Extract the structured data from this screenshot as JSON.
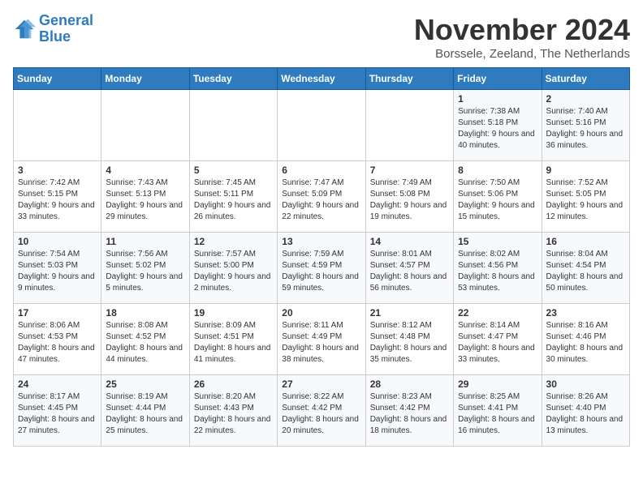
{
  "header": {
    "logo_line1": "General",
    "logo_line2": "Blue",
    "month": "November 2024",
    "location": "Borssele, Zeeland, The Netherlands"
  },
  "weekdays": [
    "Sunday",
    "Monday",
    "Tuesday",
    "Wednesday",
    "Thursday",
    "Friday",
    "Saturday"
  ],
  "weeks": [
    [
      {
        "day": "",
        "info": ""
      },
      {
        "day": "",
        "info": ""
      },
      {
        "day": "",
        "info": ""
      },
      {
        "day": "",
        "info": ""
      },
      {
        "day": "",
        "info": ""
      },
      {
        "day": "1",
        "info": "Sunrise: 7:38 AM\nSunset: 5:18 PM\nDaylight: 9 hours and 40 minutes."
      },
      {
        "day": "2",
        "info": "Sunrise: 7:40 AM\nSunset: 5:16 PM\nDaylight: 9 hours and 36 minutes."
      }
    ],
    [
      {
        "day": "3",
        "info": "Sunrise: 7:42 AM\nSunset: 5:15 PM\nDaylight: 9 hours and 33 minutes."
      },
      {
        "day": "4",
        "info": "Sunrise: 7:43 AM\nSunset: 5:13 PM\nDaylight: 9 hours and 29 minutes."
      },
      {
        "day": "5",
        "info": "Sunrise: 7:45 AM\nSunset: 5:11 PM\nDaylight: 9 hours and 26 minutes."
      },
      {
        "day": "6",
        "info": "Sunrise: 7:47 AM\nSunset: 5:09 PM\nDaylight: 9 hours and 22 minutes."
      },
      {
        "day": "7",
        "info": "Sunrise: 7:49 AM\nSunset: 5:08 PM\nDaylight: 9 hours and 19 minutes."
      },
      {
        "day": "8",
        "info": "Sunrise: 7:50 AM\nSunset: 5:06 PM\nDaylight: 9 hours and 15 minutes."
      },
      {
        "day": "9",
        "info": "Sunrise: 7:52 AM\nSunset: 5:05 PM\nDaylight: 9 hours and 12 minutes."
      }
    ],
    [
      {
        "day": "10",
        "info": "Sunrise: 7:54 AM\nSunset: 5:03 PM\nDaylight: 9 hours and 9 minutes."
      },
      {
        "day": "11",
        "info": "Sunrise: 7:56 AM\nSunset: 5:02 PM\nDaylight: 9 hours and 5 minutes."
      },
      {
        "day": "12",
        "info": "Sunrise: 7:57 AM\nSunset: 5:00 PM\nDaylight: 9 hours and 2 minutes."
      },
      {
        "day": "13",
        "info": "Sunrise: 7:59 AM\nSunset: 4:59 PM\nDaylight: 8 hours and 59 minutes."
      },
      {
        "day": "14",
        "info": "Sunrise: 8:01 AM\nSunset: 4:57 PM\nDaylight: 8 hours and 56 minutes."
      },
      {
        "day": "15",
        "info": "Sunrise: 8:02 AM\nSunset: 4:56 PM\nDaylight: 8 hours and 53 minutes."
      },
      {
        "day": "16",
        "info": "Sunrise: 8:04 AM\nSunset: 4:54 PM\nDaylight: 8 hours and 50 minutes."
      }
    ],
    [
      {
        "day": "17",
        "info": "Sunrise: 8:06 AM\nSunset: 4:53 PM\nDaylight: 8 hours and 47 minutes."
      },
      {
        "day": "18",
        "info": "Sunrise: 8:08 AM\nSunset: 4:52 PM\nDaylight: 8 hours and 44 minutes."
      },
      {
        "day": "19",
        "info": "Sunrise: 8:09 AM\nSunset: 4:51 PM\nDaylight: 8 hours and 41 minutes."
      },
      {
        "day": "20",
        "info": "Sunrise: 8:11 AM\nSunset: 4:49 PM\nDaylight: 8 hours and 38 minutes."
      },
      {
        "day": "21",
        "info": "Sunrise: 8:12 AM\nSunset: 4:48 PM\nDaylight: 8 hours and 35 minutes."
      },
      {
        "day": "22",
        "info": "Sunrise: 8:14 AM\nSunset: 4:47 PM\nDaylight: 8 hours and 33 minutes."
      },
      {
        "day": "23",
        "info": "Sunrise: 8:16 AM\nSunset: 4:46 PM\nDaylight: 8 hours and 30 minutes."
      }
    ],
    [
      {
        "day": "24",
        "info": "Sunrise: 8:17 AM\nSunset: 4:45 PM\nDaylight: 8 hours and 27 minutes."
      },
      {
        "day": "25",
        "info": "Sunrise: 8:19 AM\nSunset: 4:44 PM\nDaylight: 8 hours and 25 minutes."
      },
      {
        "day": "26",
        "info": "Sunrise: 8:20 AM\nSunset: 4:43 PM\nDaylight: 8 hours and 22 minutes."
      },
      {
        "day": "27",
        "info": "Sunrise: 8:22 AM\nSunset: 4:42 PM\nDaylight: 8 hours and 20 minutes."
      },
      {
        "day": "28",
        "info": "Sunrise: 8:23 AM\nSunset: 4:42 PM\nDaylight: 8 hours and 18 minutes."
      },
      {
        "day": "29",
        "info": "Sunrise: 8:25 AM\nSunset: 4:41 PM\nDaylight: 8 hours and 16 minutes."
      },
      {
        "day": "30",
        "info": "Sunrise: 8:26 AM\nSunset: 4:40 PM\nDaylight: 8 hours and 13 minutes."
      }
    ]
  ]
}
